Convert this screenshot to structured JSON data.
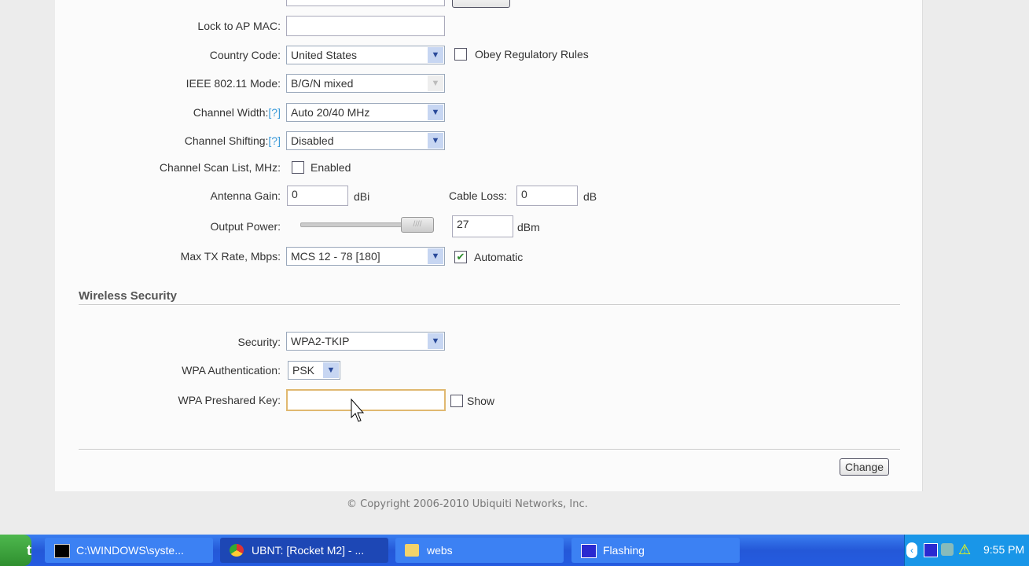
{
  "form": {
    "lock_ap_mac": {
      "label": "Lock to AP MAC:",
      "value": ""
    },
    "country_code": {
      "label": "Country Code:",
      "value": "United States"
    },
    "obey_rules": {
      "label": "Obey Regulatory Rules",
      "checked": false
    },
    "ieee_mode": {
      "label": "IEEE 802.11 Mode:",
      "value": "B/G/N mixed"
    },
    "channel_width": {
      "label": "Channel Width:",
      "help": "[?]",
      "value": "Auto 20/40 MHz"
    },
    "channel_shifting": {
      "label": "Channel Shifting:",
      "help": "[?]",
      "value": "Disabled"
    },
    "channel_scan": {
      "label": "Channel Scan List, MHz:",
      "checkbox_label": "Enabled",
      "checked": false
    },
    "antenna_gain": {
      "label": "Antenna Gain:",
      "value": "0",
      "unit": "dBi"
    },
    "cable_loss": {
      "label": "Cable Loss:",
      "value": "0",
      "unit": "dB"
    },
    "output_power": {
      "label": "Output Power:",
      "value": "27",
      "unit": "dBm",
      "slider_fraction": 1.0
    },
    "max_tx": {
      "label": "Max TX Rate, Mbps:",
      "value": "MCS 12 - 78 [180]",
      "auto_label": "Automatic",
      "auto_checked": true
    }
  },
  "security": {
    "heading": "Wireless Security",
    "security": {
      "label": "Security:",
      "value": "WPA2-TKIP"
    },
    "wpa_auth": {
      "label": "WPA Authentication:",
      "value": "PSK"
    },
    "psk": {
      "label": "WPA Preshared Key:",
      "value": "",
      "show_label": "Show",
      "show_checked": false
    }
  },
  "change_button": "Change",
  "copyright": "© Copyright 2006-2010 Ubiquiti Networks, Inc.",
  "taskbar": {
    "start": "t",
    "items": [
      {
        "label": "C:\\WINDOWS\\syste..."
      },
      {
        "label": "UBNT: [Rocket M2] - ..."
      },
      {
        "label": "webs"
      },
      {
        "label": "Flashing"
      }
    ],
    "clock": "9:55 PM"
  }
}
